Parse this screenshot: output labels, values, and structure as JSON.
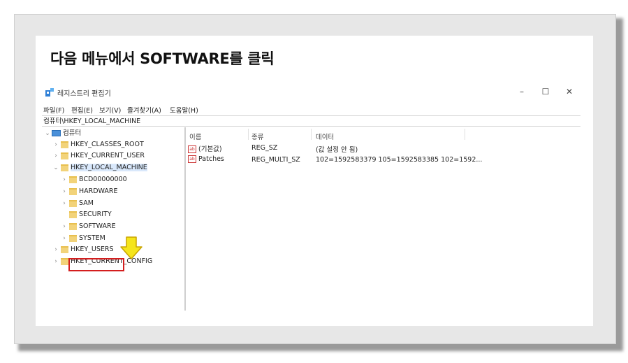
{
  "instruction": "다음 메뉴에서 SOFTWARE를 클릭",
  "window": {
    "title": "레지스트리 편집기",
    "minimize": "–",
    "maximize": "☐",
    "close": "✕"
  },
  "menu": [
    "파일(F)",
    "편집(E)",
    "보기(V)",
    "즐겨찾기(A)",
    "도움말(H)"
  ],
  "address": "컴퓨터\\HKEY_LOCAL_MACHINE",
  "tree": {
    "root": "컴퓨터",
    "hives": {
      "classes_root": "HKEY_CLASSES_ROOT",
      "current_user": "HKEY_CURRENT_USER",
      "local_machine": "HKEY_LOCAL_MACHINE",
      "users": "HKEY_USERS",
      "current_config": "HKEY_CURRENT_CONFIG"
    },
    "local_machine_children": [
      "BCD00000000",
      "HARDWARE",
      "SAM",
      "SECURITY",
      "SOFTWARE",
      "SYSTEM"
    ]
  },
  "columns": {
    "name": "이름",
    "type": "종류",
    "data": "데이터"
  },
  "values": [
    {
      "name": "(기본값)",
      "type": "REG_SZ",
      "data": "(값 설정 안 됨)"
    },
    {
      "name": "Patches",
      "type": "REG_MULTI_SZ",
      "data": "102=1592583379 105=1592583385 102=1592..."
    }
  ],
  "colors": {
    "highlight_box": "#d41e1e",
    "arrow": "#f5e51b",
    "selection": "#d9e8fb"
  },
  "icons": {
    "app": "regedit-icon",
    "computer": "computer-icon",
    "folder": "folder-icon",
    "string_value": "ab-string-icon",
    "pointer": "down-arrow-icon"
  }
}
